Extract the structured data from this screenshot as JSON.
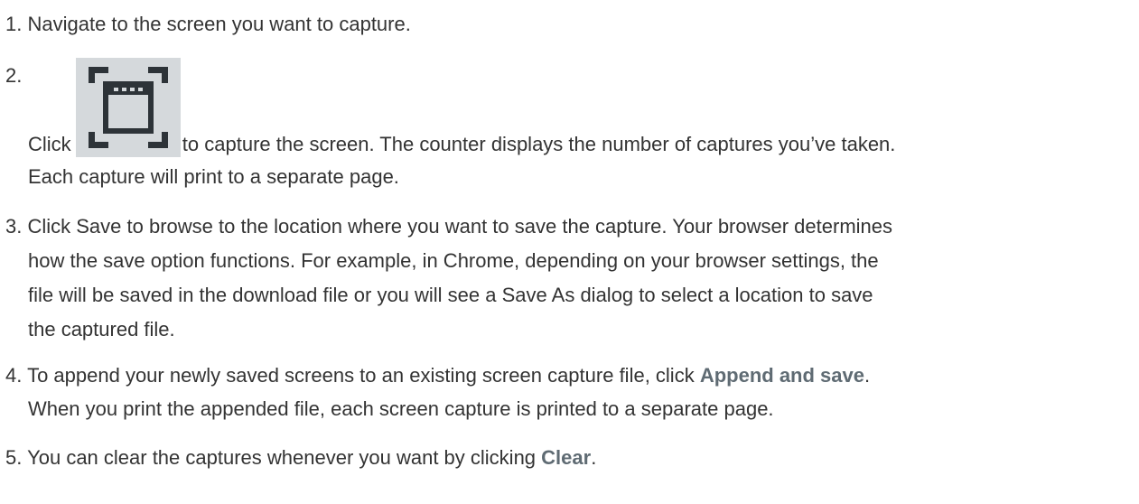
{
  "steps": [
    {
      "num": "1.",
      "text": "Navigate to the screen you want to capture."
    },
    {
      "num": "2.",
      "before": "Click",
      "icon": "screen-capture-icon",
      "line1_after": "to capture the screen. The counter displays the number of captures you’ve taken.",
      "line2": "Each capture will print to a separate page."
    },
    {
      "num": "3.",
      "line1": "Click Save to browse to the location where you want to save the capture. Your browser determines",
      "line2": "how the save option functions. For example, in Chrome, depending on your browser settings, the",
      "line3": "file will be saved in the download file or you will see a Save As dialog to select a location to save",
      "line4": "the captured file."
    },
    {
      "num": "4.",
      "line1_before": "To append your newly saved screens to an existing screen capture file, click",
      "line1_bold": "Append and save",
      "line1_after": ".",
      "line2": "When you print the appended file, each screen capture is printed to a separate page."
    },
    {
      "num": "5.",
      "before": "You can clear the captures whenever you want by clicking",
      "bold": "Clear",
      "after": "."
    }
  ],
  "colors": {
    "text": "#333333",
    "bold": "#5f6b73",
    "icon_bg": "#d5d9dc",
    "icon_fg": "#2d3338"
  }
}
